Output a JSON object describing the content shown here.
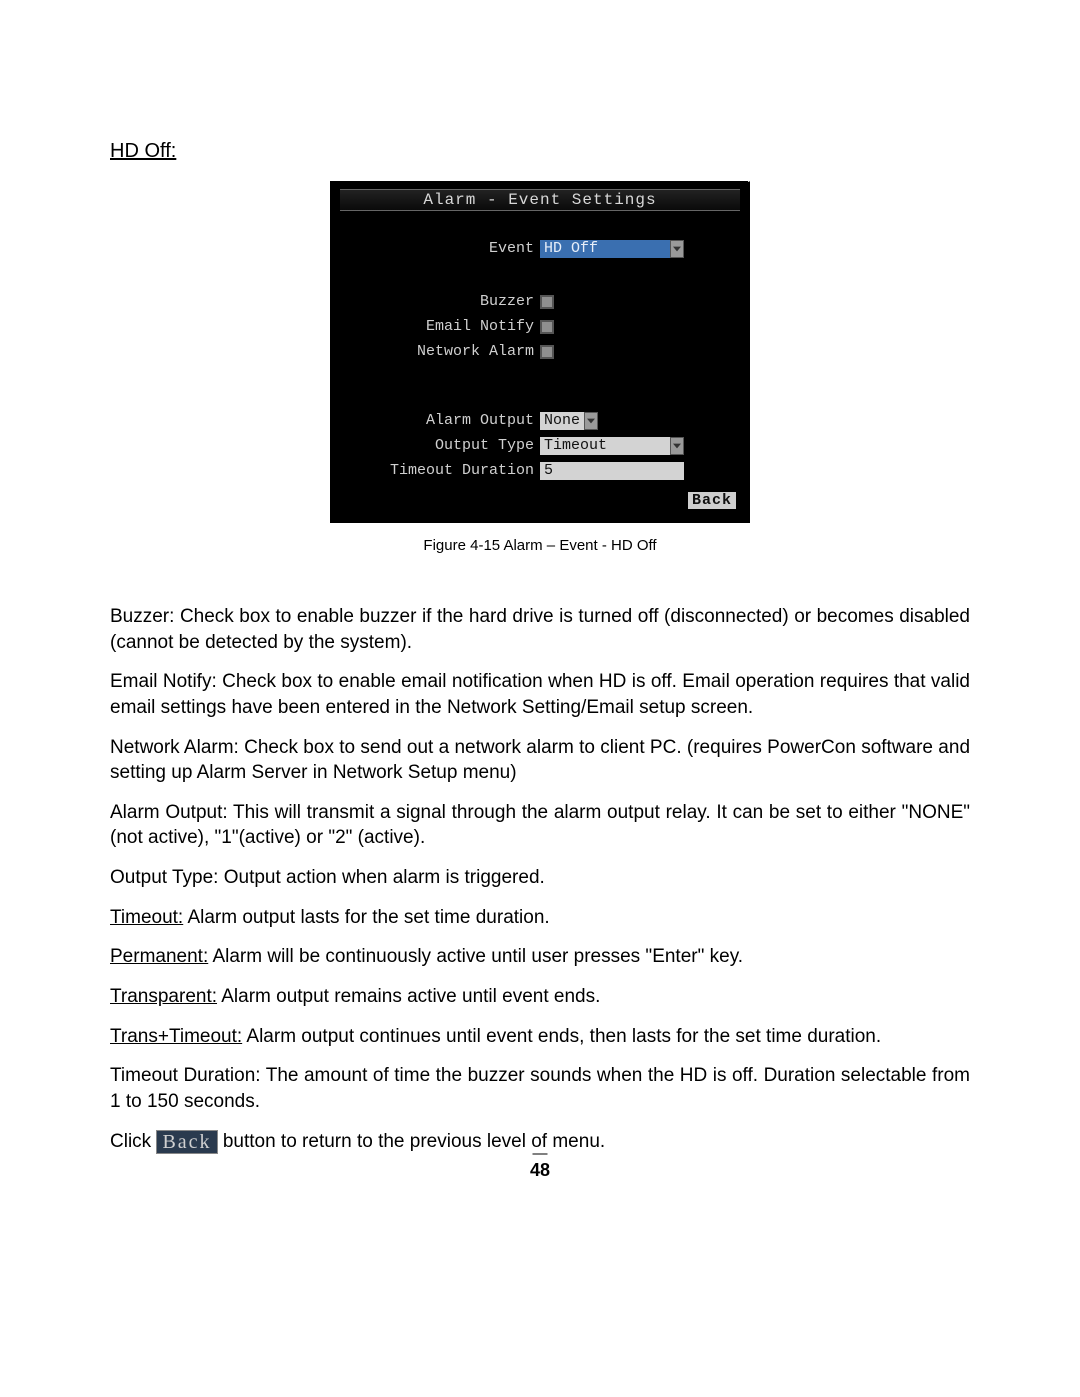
{
  "heading": "HD Off:",
  "dvr": {
    "title": "Alarm - Event Settings",
    "labels": {
      "event": "Event",
      "buzzer": "Buzzer",
      "email_notify": "Email Notify",
      "network_alarm": "Network Alarm",
      "alarm_output": "Alarm Output",
      "output_type": "Output Type",
      "timeout_duration": "Timeout Duration"
    },
    "values": {
      "event": "HD Off",
      "alarm_output": "None",
      "output_type": "Timeout",
      "timeout_duration": "5"
    },
    "back": "Back"
  },
  "caption": "Figure 4-15 Alarm – Event - HD Off",
  "paragraphs": {
    "buzzer_term": "Buzzer:",
    "buzzer_text": " Check box to enable buzzer if the hard drive is turned off (disconnected) or becomes disabled (cannot be detected by the system).",
    "email_term": "Email Notify:",
    "email_text": " Check box to enable email notification when HD is off.  Email operation requires that valid email settings have been entered in the Network Setting/Email setup screen.",
    "network_term": "Network Alarm:",
    "network_text": " Check box to send out a network alarm to client PC. (requires PowerCon software and setting up Alarm Server in Network Setup menu)",
    "alarm_output_term": "Alarm Output:",
    "alarm_output_text_a": " This will transmit a signal through the alarm output relay. It can be set to either \"",
    "alarm_output_none": "NONE",
    "alarm_output_text_b": "\" (not active), \"1\"(active) or \"2\" (active).",
    "output_type_term": "Output Type:",
    "output_type_text": " Output action when alarm is triggered.",
    "sub_timeout_u": "Timeout:",
    "sub_timeout_t": " Alarm output lasts for the set time duration.",
    "sub_permanent_u": "Permanent:",
    "sub_permanent_t_a": " Alarm will be continuously active until user presses \"",
    "sub_permanent_enter": "Enter",
    "sub_permanent_t_b": "\" key.",
    "sub_transparent_u": "Transparent:",
    "sub_transparent_t": " Alarm output remains active until event ends.",
    "sub_trans_u": "Trans+Timeout:",
    "sub_trans_t": " Alarm output continues until event ends, then lasts for the set time duration.",
    "timeout_dur_term": "Timeout Duration:",
    "timeout_dur_text": " The amount of time the buzzer sounds when the HD is off. Duration selectable from 1 to 150 seconds.",
    "click_a": "Click ",
    "click_back": "Back",
    "click_b": " button to return to the previous level of menu."
  },
  "page_number": "48"
}
